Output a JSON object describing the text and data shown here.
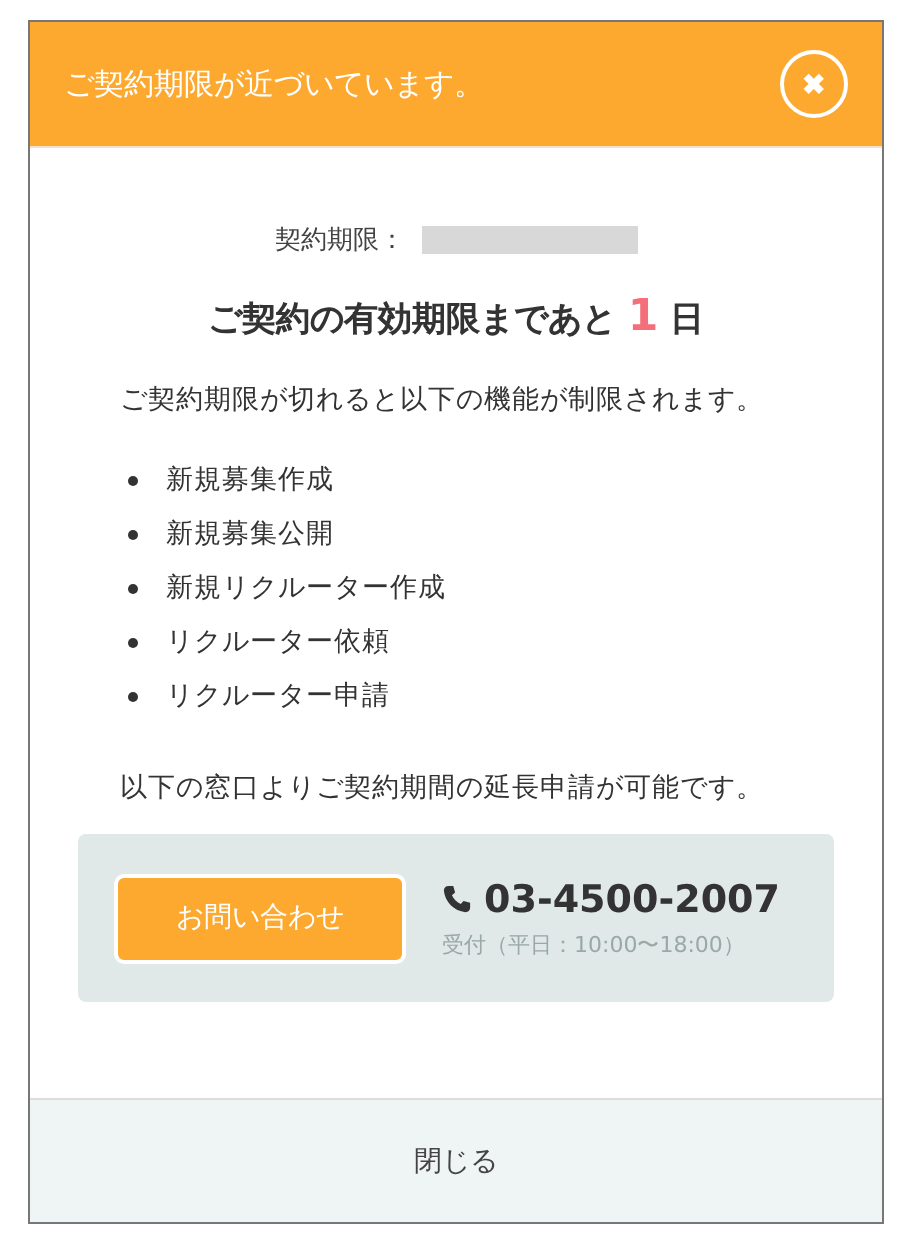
{
  "header": {
    "title": "ご契約期限が近づいています。",
    "close_icon": "✖"
  },
  "deadline": {
    "label": "契約期限："
  },
  "headline": {
    "before": "ご契約の有効期限まであと",
    "days": "1",
    "after": "日"
  },
  "intro": "ご契約期限が切れると以下の機能が制限されます。",
  "features": [
    "新規募集作成",
    "新規募集公開",
    "新規リクルーター作成",
    "リクルーター依頼",
    "リクルーター申請"
  ],
  "note": "以下の窓口よりご契約期間の延長申請が可能です。",
  "contact": {
    "button": "お問い合わせ",
    "phone": "03-4500-2007",
    "hours": "受付（平日：10:00〜18:00）"
  },
  "footer": {
    "button": "閉じる"
  }
}
